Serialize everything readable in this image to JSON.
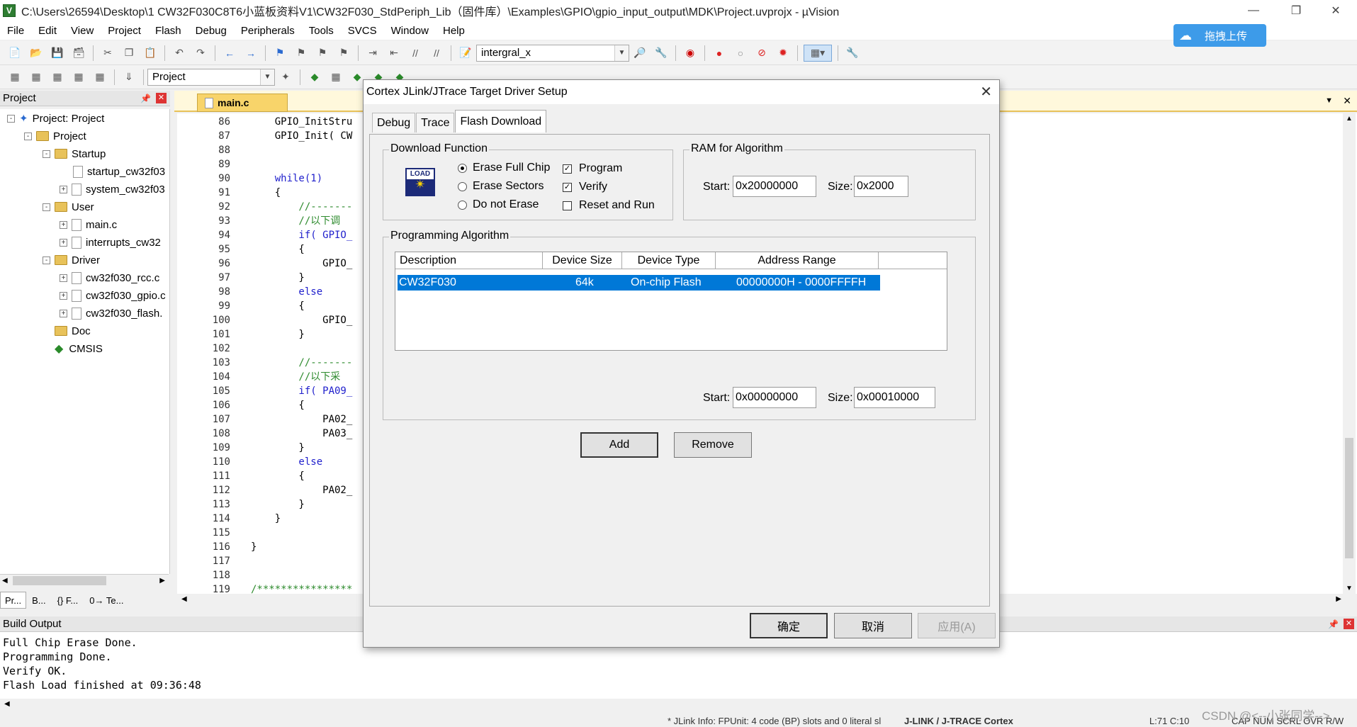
{
  "window": {
    "title": "C:\\Users\\26594\\Desktop\\1 CW32F030C8T6小蓝板资料V1\\CW32F030_StdPeriph_Lib（固件库）\\Examples\\GPIO\\gpio_input_output\\MDK\\Project.uvprojx - µVision"
  },
  "menu": [
    "File",
    "Edit",
    "View",
    "Project",
    "Flash",
    "Debug",
    "Peripherals",
    "Tools",
    "SVCS",
    "Window",
    "Help"
  ],
  "toolbar": {
    "target_combo": "intergral_x",
    "project_combo": "Project"
  },
  "upload_button": "拖拽上传",
  "project_panel": {
    "title": "Project",
    "items": [
      {
        "label": "Project: Project"
      },
      {
        "label": "Project"
      },
      {
        "label": "Startup"
      },
      {
        "label": "startup_cw32f03"
      },
      {
        "label": "system_cw32f03"
      },
      {
        "label": "User"
      },
      {
        "label": "main.c"
      },
      {
        "label": "interrupts_cw32"
      },
      {
        "label": "Driver"
      },
      {
        "label": "cw32f030_rcc.c"
      },
      {
        "label": "cw32f030_gpio.c"
      },
      {
        "label": "cw32f030_flash."
      },
      {
        "label": "Doc"
      },
      {
        "label": "CMSIS"
      }
    ],
    "bottom_tabs": [
      "Pr...",
      "B...",
      "{} F...",
      "0→ Te..."
    ]
  },
  "editor": {
    "tab": "main.c",
    "lines": [
      {
        "n": "86",
        "t": "    GPIO_InitStru"
      },
      {
        "n": "87",
        "t": "    GPIO_Init( CW"
      },
      {
        "n": "88",
        "t": ""
      },
      {
        "n": "89",
        "t": ""
      },
      {
        "n": "90",
        "t": "    while(1)"
      },
      {
        "n": "91",
        "t": "    {"
      },
      {
        "n": "92",
        "t": "        //-------"
      },
      {
        "n": "93",
        "t": "        //以下调"
      },
      {
        "n": "94",
        "t": "        if( GPIO_"
      },
      {
        "n": "95",
        "t": "        {"
      },
      {
        "n": "96",
        "t": "            GPIO_"
      },
      {
        "n": "97",
        "t": "        }"
      },
      {
        "n": "98",
        "t": "        else"
      },
      {
        "n": "99",
        "t": "        {"
      },
      {
        "n": "100",
        "t": "            GPIO_"
      },
      {
        "n": "101",
        "t": "        }"
      },
      {
        "n": "102",
        "t": ""
      },
      {
        "n": "103",
        "t": "        //-------"
      },
      {
        "n": "104",
        "t": "        //以下采"
      },
      {
        "n": "105",
        "t": "        if( PA09_"
      },
      {
        "n": "106",
        "t": "        {"
      },
      {
        "n": "107",
        "t": "            PA02_"
      },
      {
        "n": "108",
        "t": "            PA03_"
      },
      {
        "n": "109",
        "t": "        }"
      },
      {
        "n": "110",
        "t": "        else"
      },
      {
        "n": "111",
        "t": "        {"
      },
      {
        "n": "112",
        "t": "            PA02_"
      },
      {
        "n": "113",
        "t": "        }"
      },
      {
        "n": "114",
        "t": "    }"
      },
      {
        "n": "115",
        "t": ""
      },
      {
        "n": "116",
        "t": "}"
      },
      {
        "n": "117",
        "t": ""
      },
      {
        "n": "118",
        "t": ""
      },
      {
        "n": "119",
        "t": "/****************"
      }
    ]
  },
  "build_output": {
    "title": "Build Output",
    "lines": [
      "Full Chip Erase Done.",
      "Programming Done.",
      "Verify OK.",
      "Flash Load finished at 09:36:48"
    ]
  },
  "status": {
    "info": "* JLink Info: FPUnit: 4 code (BP) slots and 0 literal sl",
    "debugger": "J-LINK / J-TRACE Cortex",
    "pos": "L:71 C:10",
    "flags": "CAP  NUM  SCRL  OVR  R/W",
    "watermark": "CSDN @<--小张同学-->"
  },
  "dialog": {
    "title": "Cortex JLink/JTrace Target Driver Setup",
    "tabs": [
      "Debug",
      "Trace",
      "Flash Download"
    ],
    "download_function": {
      "label": "Download Function",
      "icon_text": "LOAD",
      "erase_options": [
        "Erase Full Chip",
        "Erase Sectors",
        "Do not Erase"
      ],
      "checks": [
        "Program",
        "Verify",
        "Reset and Run"
      ]
    },
    "ram": {
      "label": "RAM for Algorithm",
      "start_label": "Start:",
      "start": "0x20000000",
      "size_label": "Size:",
      "size": "0x2000"
    },
    "prog": {
      "label": "Programming Algorithm",
      "headers": [
        "Description",
        "Device Size",
        "Device Type",
        "Address Range"
      ],
      "row": {
        "desc": "CW32F030",
        "size": "64k",
        "type": "On-chip Flash",
        "range": "00000000H - 0000FFFFH"
      },
      "start_label": "Start:",
      "start": "0x00000000",
      "size_label": "Size:",
      "size": "0x00010000"
    },
    "buttons": {
      "add": "Add",
      "remove": "Remove",
      "ok": "确定",
      "cancel": "取消",
      "apply": "应用(A)"
    }
  }
}
